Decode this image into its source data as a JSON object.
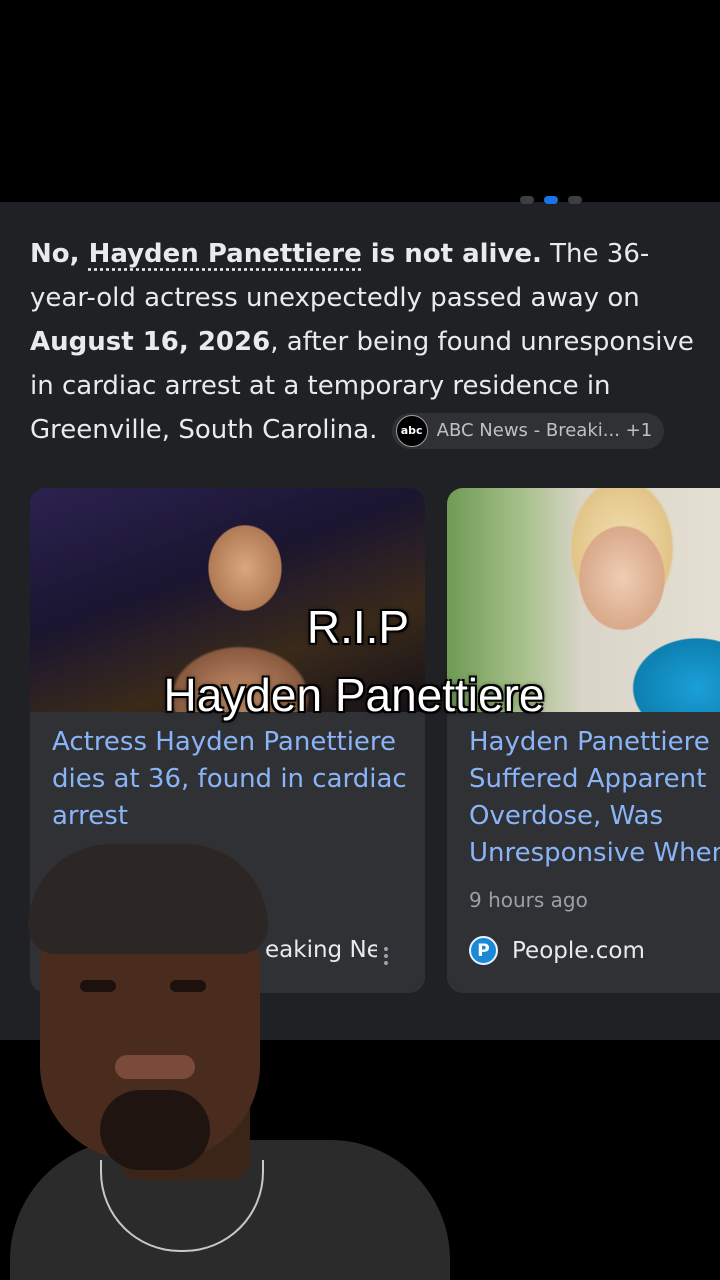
{
  "answer": {
    "lead_no": "No, ",
    "subject": "Hayden Panettiere",
    "lead_rest": " is not alive.",
    "text1": " The 36-year-old actress unexpectedly passed away on ",
    "date": "August 16, 2026",
    "text2": ", after being found unresponsive in cardiac arrest at a temporary residence in Greenville, South Carolina.",
    "source_chip": {
      "logo": "abc",
      "label": "ABC News - Breaki... +1"
    }
  },
  "cards": [
    {
      "title": "Actress Hayden Panettiere dies at 36, found in cardiac arrest",
      "source": "eaking Ne"
    },
    {
      "title_lines": [
        "Hayden Panettiere",
        "Suffered Apparent",
        "Overdose, Was",
        "Unresponsive When"
      ],
      "time": "9 hours ago",
      "source_logo": "P",
      "source": "People.com"
    }
  ],
  "overlay": {
    "line1": "R.I.P",
    "line2": "Hayden Panettiere"
  },
  "colors": {
    "background": "#000000",
    "panel": "#202124",
    "card": "#303134",
    "link": "#8ab4f8",
    "text": "#e8eaed"
  }
}
